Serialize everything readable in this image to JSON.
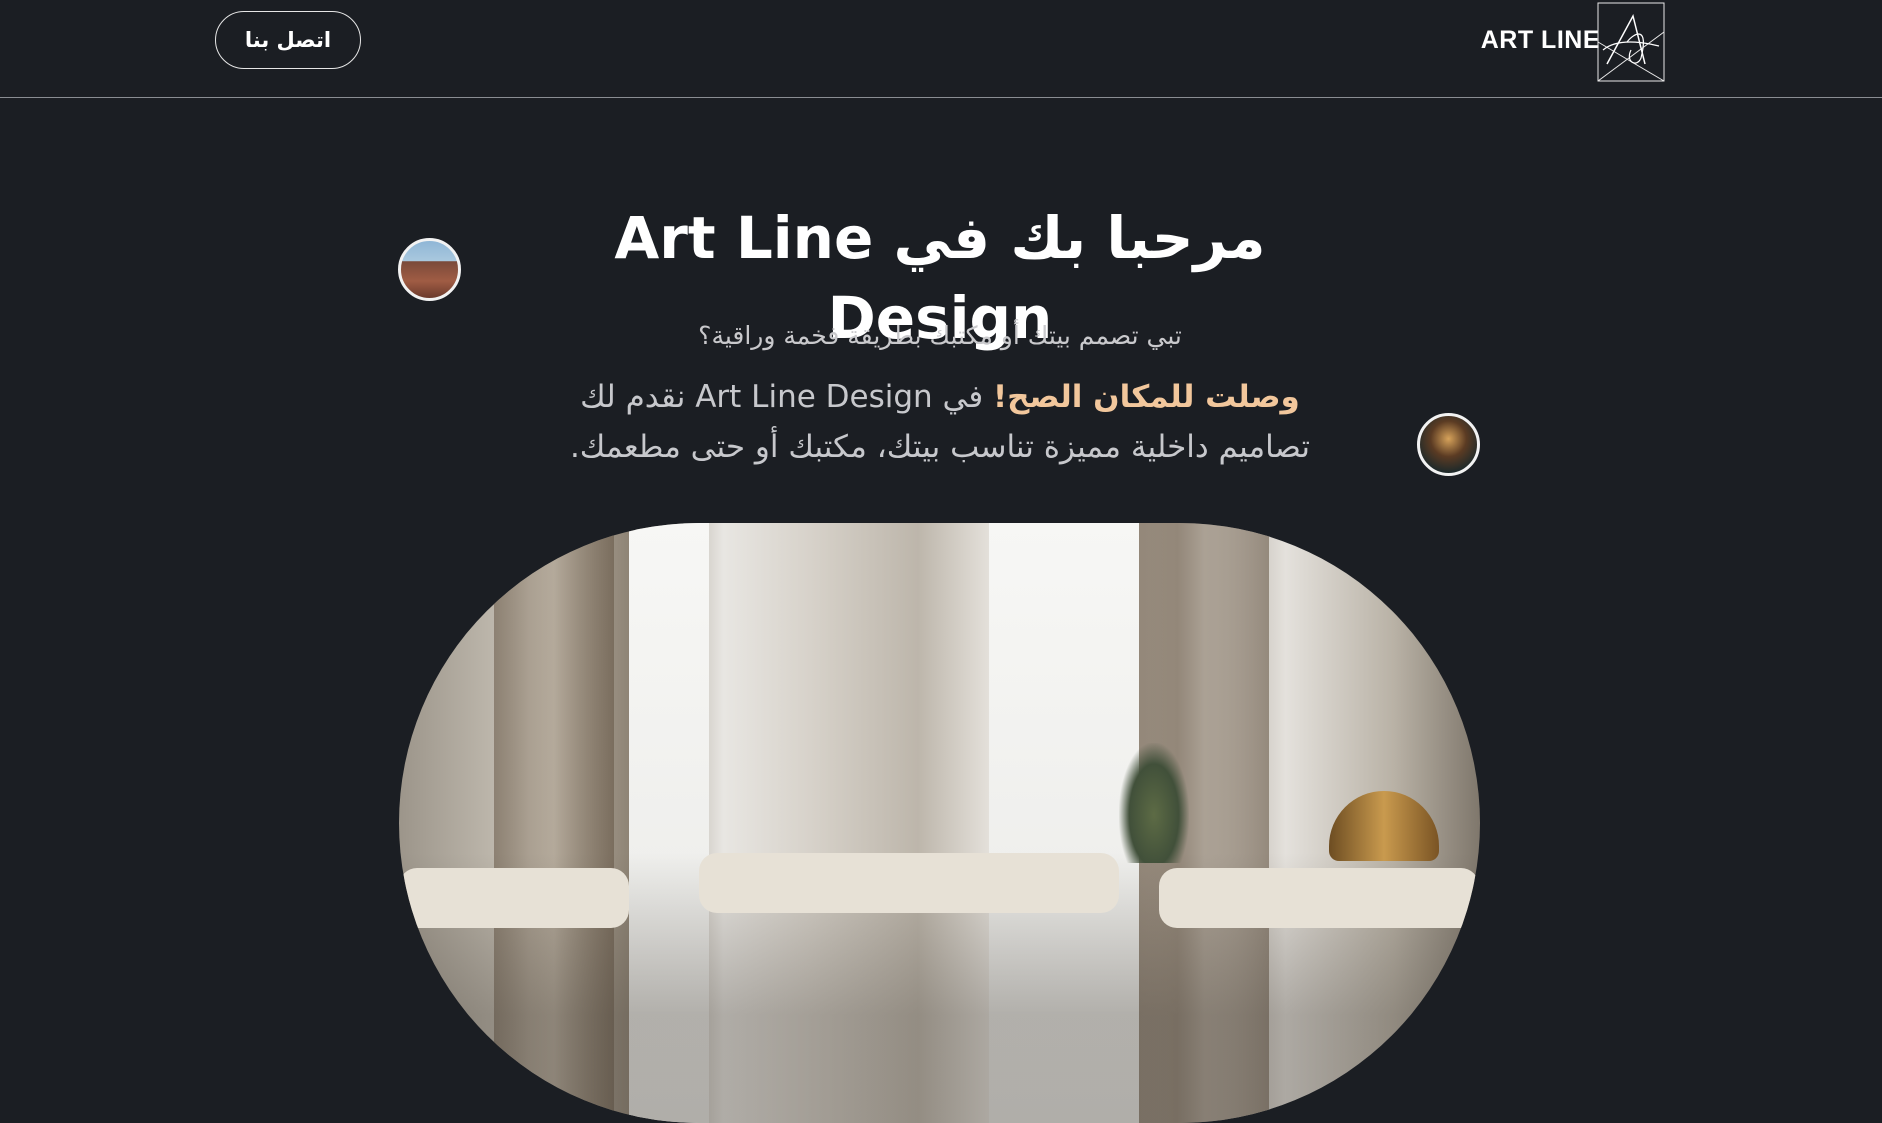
{
  "header": {
    "brand": "ART LINE",
    "contact_label": "اتصل بنا",
    "logo_icon": "art-line-logo-icon"
  },
  "hero": {
    "title": "مرحبا بك في Art Line Design",
    "subtitle": "تبي تصمم بيتك أو مكتبك بطريقة فخمة وراقية؟",
    "lead_highlight": "وصلت للمكان الصح!",
    "lead_middle": " في Art Line Design نقدم لك",
    "lead_line2": "تصاميم داخلية مميزة تناسب بيتك، مكتبك أو حتى مطعمك."
  },
  "colors": {
    "background": "#1b1e23",
    "accent": "#f2c79c",
    "text": "#ffffff",
    "muted": "#c7c8cc"
  }
}
